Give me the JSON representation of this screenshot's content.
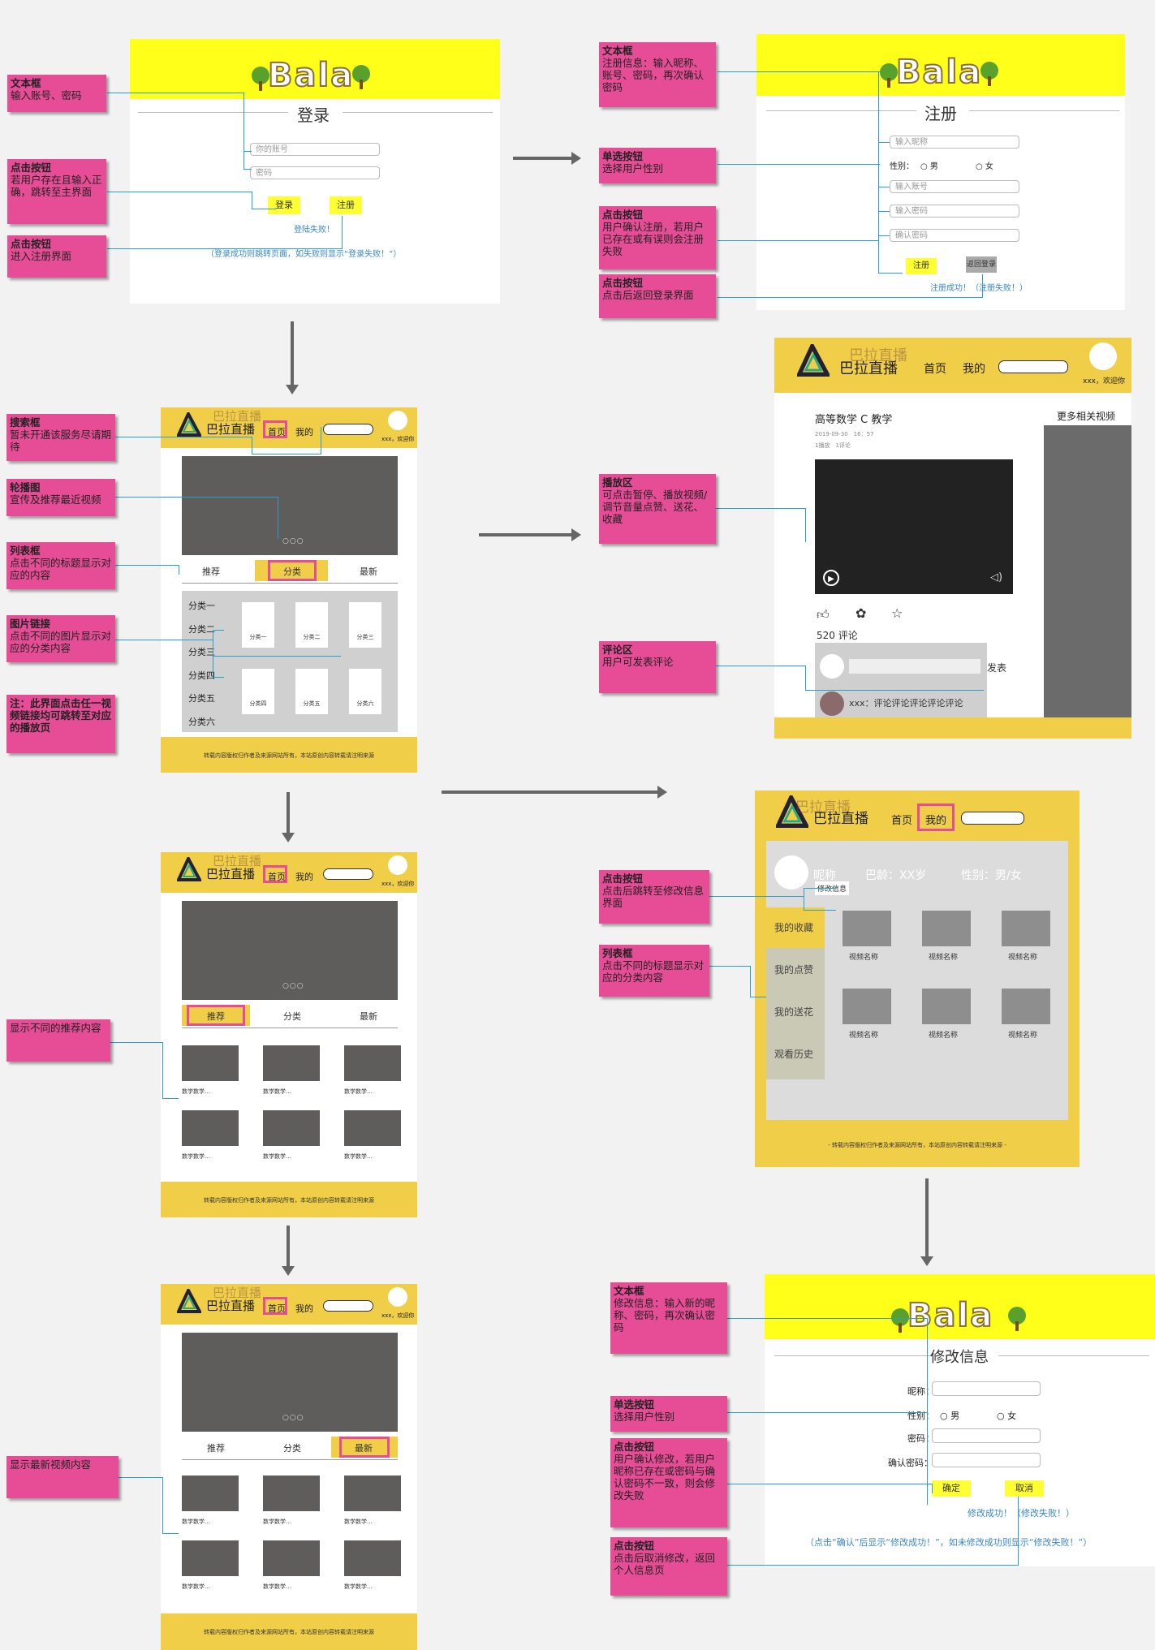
{
  "login": {
    "brand": "Bala",
    "title": "登录",
    "account_placeholder": "你的账号",
    "password_placeholder": "密码",
    "login_btn": "登录",
    "register_btn": "注册",
    "fail_link": "登陆失败！",
    "hint": "（登录成功则跳转页面，如失败则显示“登录失败！”）"
  },
  "register": {
    "brand": "Bala",
    "title": "注册",
    "nickname_placeholder": "输入昵称",
    "gender_label": "性别：",
    "male": "男",
    "female": "女",
    "account_placeholder": "输入账号",
    "password_placeholder": "输入密码",
    "confirm_placeholder": "确认密码",
    "register_btn": "注册",
    "back_btn": "返回登录",
    "result_link": "注册成功！（注册失败！）"
  },
  "notes": {
    "login_textbox_title": "文本框",
    "login_textbox_body": "输入账号、密码",
    "login_click_title": "点击按钮",
    "login_click_body": "若用户存在且输入正确，跳转至主界面",
    "login_reg_title": "点击按钮",
    "login_reg_body": "进入注册界面",
    "reg_textbox_title": "文本框",
    "reg_textbox_body": "注册信息：输入昵称、账号、密码，再次确认密码",
    "reg_radio_title": "单选按钮",
    "reg_radio_body": "选择用户性别",
    "reg_click_title": "点击按钮",
    "reg_click_body": "用户确认注册，若用户已存在或有误则会注册失败",
    "reg_back_title": "点击按钮",
    "reg_back_body": "点击后返回登录界面",
    "search_title": "搜索框",
    "search_body": "暂未开通该服务尽请期待",
    "carousel_title": "轮播图",
    "carousel_body": "宣传及推荐最近视频",
    "list_title": "列表框",
    "list_body": "点击不同的标题显示对应的内容",
    "imglink_title": "图片链接",
    "imglink_body": "点击不同的图片显示对应的分类内容",
    "warn": "注：此界面点击任一视频链接均可跳转至对应的播放页",
    "play_title": "播放区",
    "play_body": "可点击暂停、播放视频/调节音量点赞、送花、收藏",
    "comment_title": "评论区",
    "comment_body": "用户可发表评论",
    "recommend": "显示不同的推荐内容",
    "newest": "显示最新视频内容",
    "mine_click_title": "点击按钮",
    "mine_click_body": "点击后跳转至修改信息界面",
    "mine_list_title": "列表框",
    "mine_list_body": "点击不同的标题显示对应的分类内容",
    "edit_textbox_title": "文本框",
    "edit_textbox_body": "修改信息：输入新的昵称、密码，再次确认密码",
    "edit_radio_title": "单选按钮",
    "edit_radio_body": "选择用户性别",
    "edit_click_title": "点击按钮",
    "edit_click_body": "用户确认修改，若用户昵称已存在或密码与确认密码不一致，则会修改失败",
    "edit_cancel_title": "点击按钮",
    "edit_cancel_body": "点击后取消修改，返回个人信息页"
  },
  "header": {
    "site_name": "巴拉直播",
    "site_ghost": "巴拉直播",
    "nav_home": "首页",
    "nav_mine": "我的",
    "welcome": "xxx，欢迎你"
  },
  "home": {
    "tab_recommend": "推荐",
    "tab_category": "分类",
    "tab_newest": "最新",
    "dots": "○○○",
    "categories": [
      "分类一",
      "分类二",
      "分类三",
      "分类四",
      "分类五",
      "分类六"
    ],
    "category_cards": [
      "分类一",
      "分类二",
      "分类三",
      "分类四",
      "分类五",
      "分类六"
    ],
    "video_caption": "数学数学…",
    "footer": "转载内容版权归作者及来源网站所有，本站原创内容转载请注明来源"
  },
  "player": {
    "video_title": "高等数学 C 教学",
    "meta_date": "2019-09-30　16：57",
    "meta_stats": "1播放　1评论",
    "related": "更多相关视频",
    "comments_count": "520 评论",
    "publish": "发表",
    "comment_text": "xxx：评论评论评论评论评论"
  },
  "mine": {
    "nickname": "昵称",
    "age": "巴龄：XX岁",
    "gender": "性别：男/女",
    "edit": "修改信息",
    "menu": [
      "我的收藏",
      "我的点赞",
      "我的送花",
      "观看历史"
    ],
    "video_name": "视频名称",
    "footer": "- 转载内容版权归作者及来源网站所有，本站原创内容转载请注明来源 -"
  },
  "edit": {
    "brand": "Bala",
    "title": "修改信息",
    "nickname_label": "昵称：",
    "gender_label": "性别：",
    "male": "男",
    "female": "女",
    "password_label": "密码：",
    "confirm_label": "确认密码：",
    "confirm_btn": "确定",
    "cancel_btn": "取消",
    "result_link": "修改成功！（修改失败！）",
    "hint": "（点击“确认”后显示“修改成功！”，如未修改成功则显示“修改失败！”）"
  },
  "colors": {
    "note_pink": "#e64d96",
    "header_gold": "#f0ce48",
    "login_yellow": "#ffff1a",
    "connector_blue": "#2a9fc9"
  }
}
